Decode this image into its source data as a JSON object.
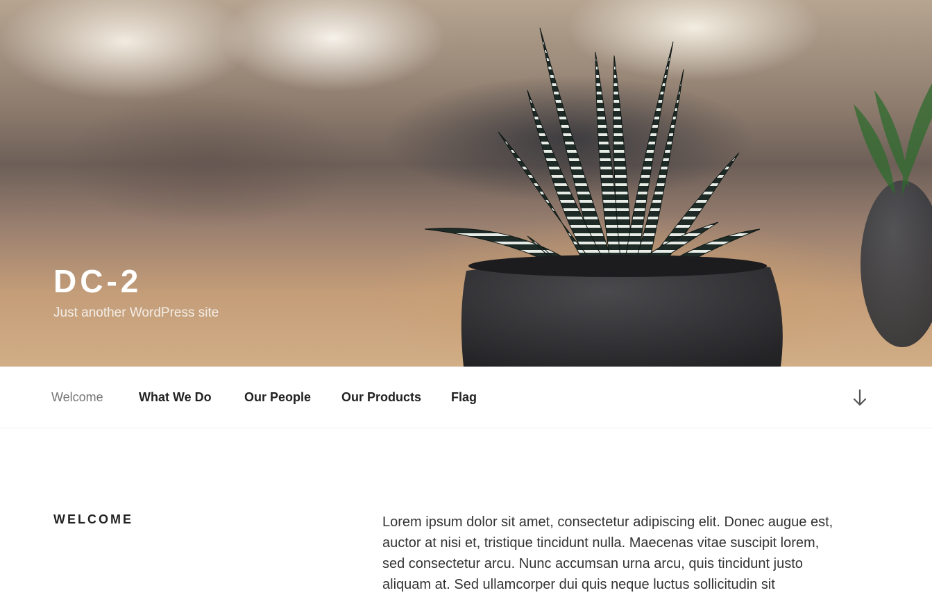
{
  "site": {
    "title": "DC-2",
    "tagline": "Just another WordPress site"
  },
  "nav": {
    "items": [
      {
        "label": "Welcome",
        "current": true
      },
      {
        "label": "What We Do",
        "current": false
      },
      {
        "label": "Our People",
        "current": false
      },
      {
        "label": "Our Products",
        "current": false
      },
      {
        "label": "Flag",
        "current": false
      }
    ],
    "scroll_icon": "arrow-down-icon"
  },
  "page": {
    "heading": "Welcome",
    "body": "Lorem ipsum dolor sit amet, consectetur adipiscing elit. Donec augue est, auctor at nisi et, tristique tincidunt nulla. Maecenas vitae suscipit lorem, sed consectetur arcu. Nunc accumsan urna arcu, quis tincidunt justo aliquam at. Sed ullamcorper dui quis neque luctus sollicitudin sit"
  },
  "colors": {
    "nav_current": "#767676",
    "nav_text": "#222222",
    "header_text": "#ffffff"
  }
}
